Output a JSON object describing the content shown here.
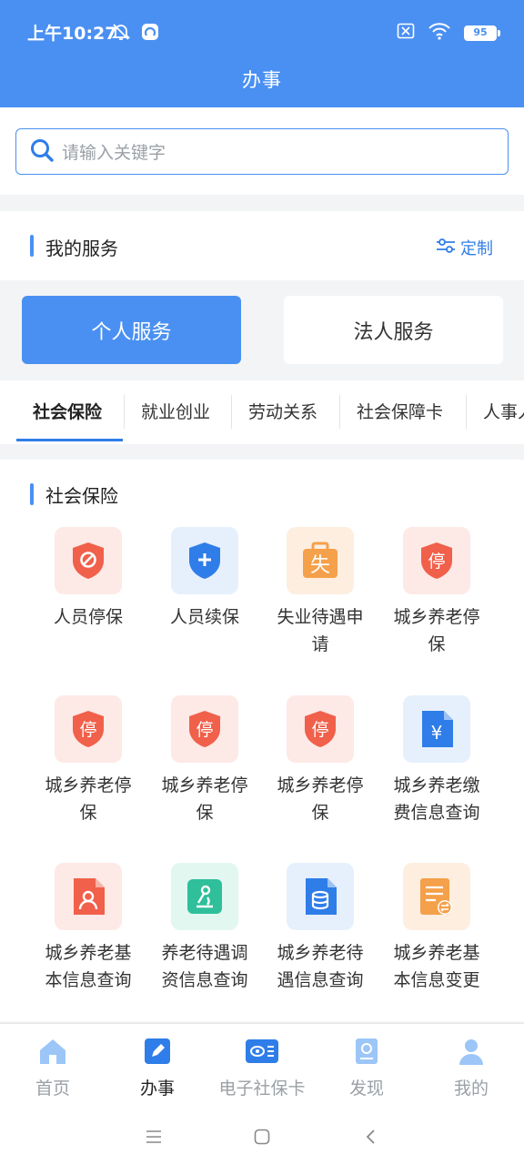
{
  "status_bar": {
    "time": "上午10:27",
    "battery": "95"
  },
  "header": {
    "title": "办事"
  },
  "search": {
    "placeholder": "请输入关键字"
  },
  "my_services": {
    "title": "我的服务",
    "customize_label": "定制"
  },
  "service_type": {
    "personal": "个人服务",
    "legal": "法人服务"
  },
  "categories": [
    "社会保险",
    "就业创业",
    "劳动关系",
    "社会保障卡",
    "人事人"
  ],
  "section": {
    "title": "社会保险"
  },
  "services": [
    {
      "label": "人员停保",
      "icon": "shield-ban-icon"
    },
    {
      "label": "人员续保",
      "icon": "shield-plus-icon"
    },
    {
      "label": "失业待遇申请",
      "icon": "unemployment-bag-icon"
    },
    {
      "label": "城乡养老停保",
      "icon": "stop-shield-icon"
    },
    {
      "label": "城乡养老停保",
      "icon": "stop-shield-icon"
    },
    {
      "label": "城乡养老停保",
      "icon": "stop-shield-icon"
    },
    {
      "label": "城乡养老停保",
      "icon": "stop-shield-icon"
    },
    {
      "label": "城乡养老缴费信息查询",
      "icon": "yuan-document-icon"
    },
    {
      "label": "城乡养老基本信息查询",
      "icon": "person-document-icon"
    },
    {
      "label": "养老待遇调资信息查询",
      "icon": "microscope-icon"
    },
    {
      "label": "城乡养老待遇信息查询",
      "icon": "coins-document-icon"
    },
    {
      "label": "城乡养老基本信息变更",
      "icon": "exchange-document-icon"
    }
  ],
  "tabbar": [
    {
      "label": "首页",
      "icon": "home-icon"
    },
    {
      "label": "办事",
      "icon": "edit-icon"
    },
    {
      "label": "电子社保卡",
      "icon": "card-icon"
    },
    {
      "label": "发现",
      "icon": "discover-icon"
    },
    {
      "label": "我的",
      "icon": "profile-icon"
    }
  ],
  "colors": {
    "primary": "#4a90f2",
    "link": "#2f7de8",
    "red": "#f0604a",
    "blue": "#2f7de8",
    "orange": "#f5a04a",
    "teal": "#2fbf9a"
  }
}
